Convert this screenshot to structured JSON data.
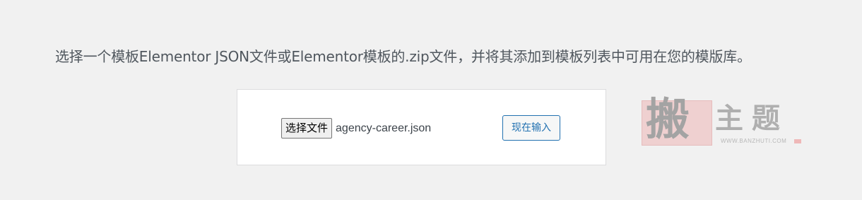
{
  "instructions": {
    "text": "选择一个模板Elementor JSON文件或Elementor模板的.zip文件，并将其添加到模板列表中可用在您的模版库。"
  },
  "upload": {
    "file_button_label": "选择文件",
    "file_name": "agency-career.json",
    "import_button_label": "现在输入"
  },
  "watermark": {
    "seal_char": "搬",
    "text": "主题",
    "url": "WWW.BANZHUTI.COM"
  },
  "colors": {
    "background": "#f1f1f1",
    "accent": "#2271b1",
    "text": "#50575e"
  }
}
